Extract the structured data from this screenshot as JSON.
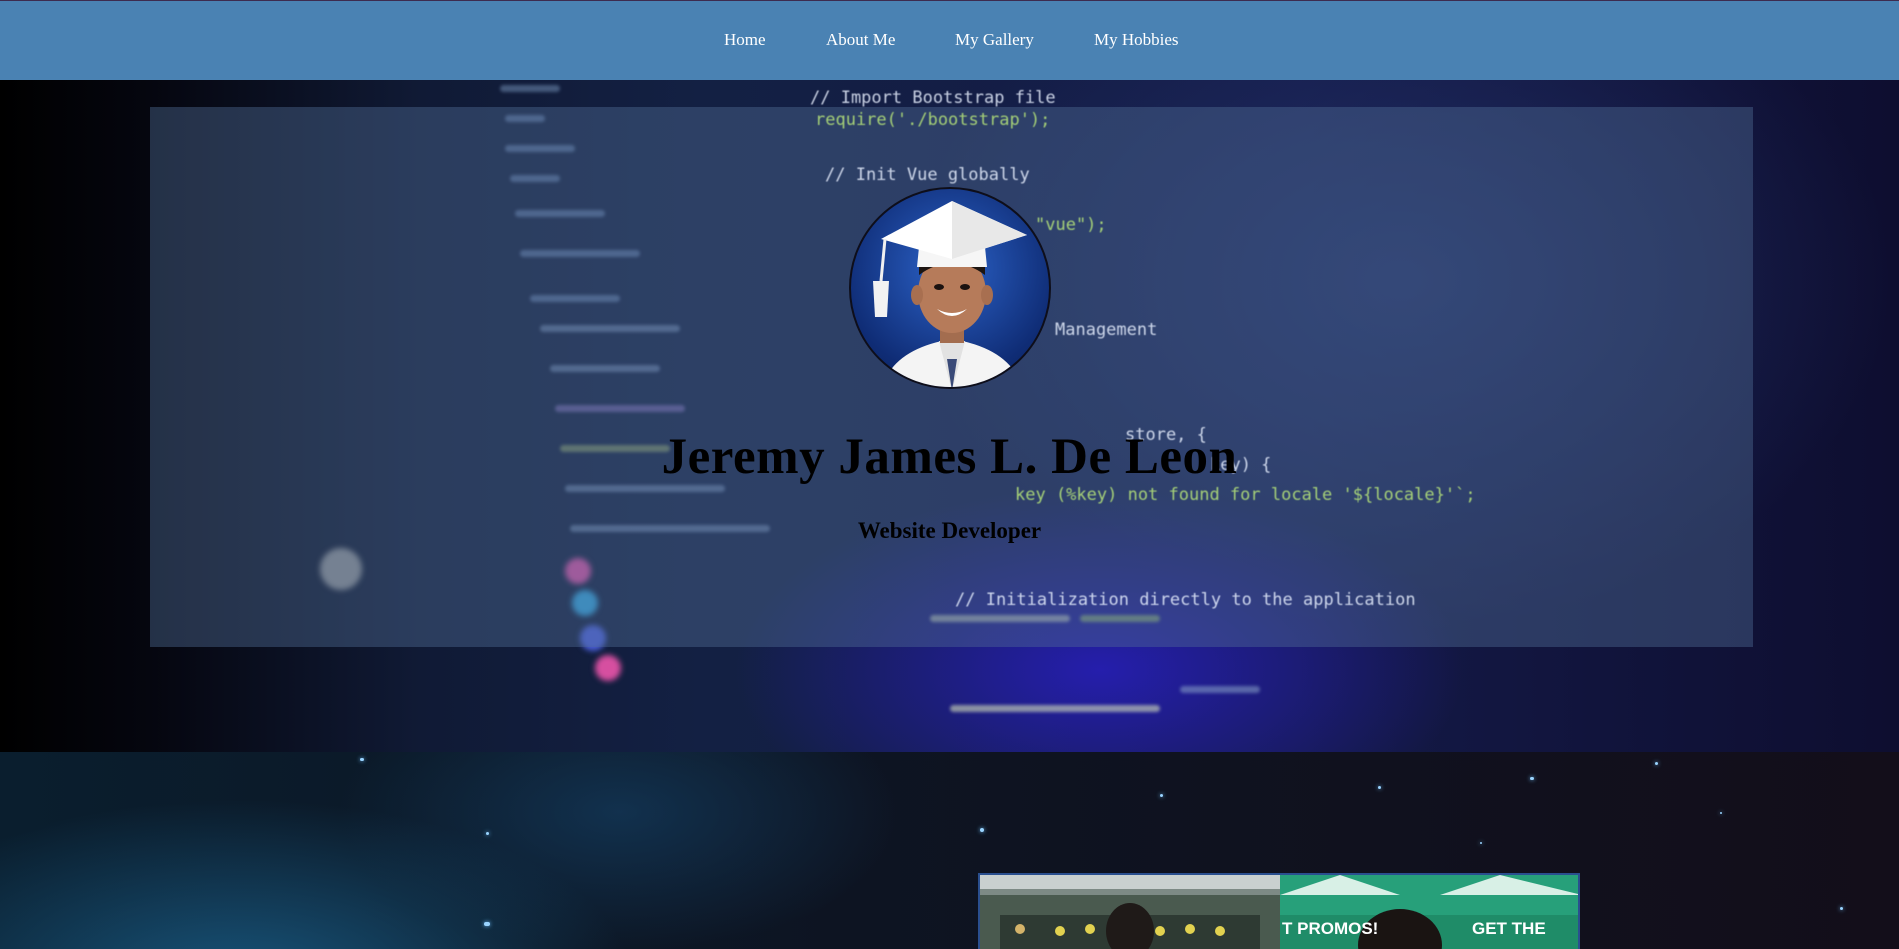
{
  "nav": {
    "items": [
      {
        "label": "Home"
      },
      {
        "label": "About Me"
      },
      {
        "label": "My Gallery"
      },
      {
        "label": "My Hobbies"
      }
    ]
  },
  "hero": {
    "name": "Jeremy James L. De Leon",
    "role": "Website Developer",
    "background_code": [
      "// Import Bootstrap file",
      "require('./bootstrap');",
      "// Init Vue globally",
      "\"vue\");",
      "Management",
      "store, {",
      "key) {",
      "key (%key) not found for locale '${locale}'`;",
      "// Initialization directly to the application"
    ]
  },
  "gallery_photo": {
    "sign_text": "GET THE",
    "sign_text_left": "T PROMOS!"
  },
  "colors": {
    "navbar": "#4a82b3",
    "nav_text": "#ffffff",
    "hero_panel": "rgba(80,110,150,0.42)",
    "heading_text": "#000000"
  }
}
